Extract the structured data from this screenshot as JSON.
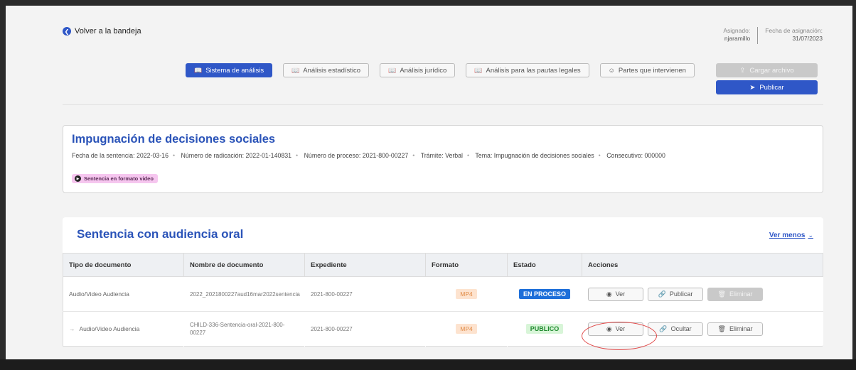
{
  "header": {
    "back_label": "Volver a la bandeja",
    "assigned_label": "Asignado:",
    "assigned_value": "njaramillo",
    "date_label": "Fecha de asignación:",
    "date_value": "31/07/2023"
  },
  "tabs": [
    {
      "label": "Sistema de análisis",
      "active": true
    },
    {
      "label": "Análisis estadístico",
      "active": false
    },
    {
      "label": "Análisis jurídico",
      "active": false
    },
    {
      "label": "Análisis para las pautas legales",
      "active": false
    },
    {
      "label": "Partes que intervienen",
      "active": false
    }
  ],
  "actions": {
    "upload_label": "Cargar archivo",
    "publish_label": "Publicar"
  },
  "case": {
    "title": "Impugnación de decisiones sociales",
    "meta": [
      "Fecha de la sentencia: 2022-03-16",
      "Número de radicación: 2022-01-140831",
      "Número de proceso: 2021-800-00227",
      "Trámite: Verbal",
      "Tema: Impugnación de decisiones sociales",
      "Consecutivo: 000000"
    ],
    "video_badge": "Sentencia en formato video"
  },
  "section": {
    "title": "Sentencia con audiencia oral",
    "toggle_label": "Ver menos"
  },
  "table": {
    "headers": [
      "Tipo de documento",
      "Nombre de documento",
      "Expediente",
      "Formato",
      "Estado",
      "Acciones"
    ],
    "rows": [
      {
        "tipo": "Audio/Video Audiencia",
        "nombre": "2022_2021800227aud16mar2022sentencia",
        "expediente": "2021-800-00227",
        "formato": "MP4",
        "estado": "EN PROCESO",
        "btn1": "Ver",
        "btn2": "Publicar",
        "btn3": "Eliminar"
      },
      {
        "tipo": "Audio/Video Audiencia",
        "nombre": "CHILD-336-Sentencia-oral-2021-800-00227",
        "expediente": "2021-800-00227",
        "formato": "MP4",
        "estado": "PUBLICO",
        "btn1": "Ver",
        "btn2": "Ocultar",
        "btn3": "Eliminar"
      }
    ]
  },
  "colors": {
    "primary": "#2f57c7",
    "title": "#2a53b8",
    "status_processing": "#1e6fd9",
    "status_public": "#1f8a2e",
    "format_badge": "#e08a45",
    "highlight_circle": "#e04848"
  }
}
